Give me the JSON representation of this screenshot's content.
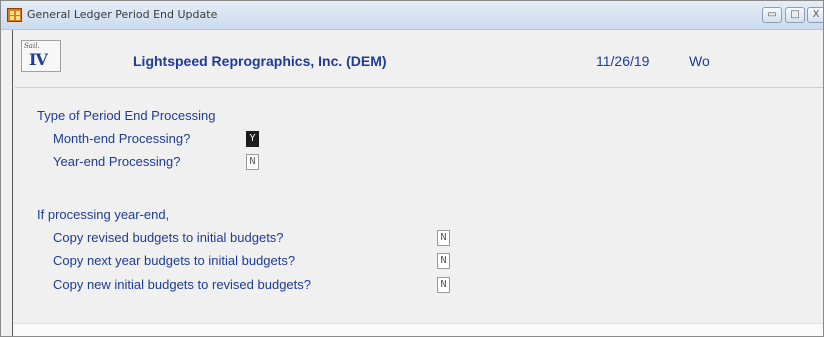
{
  "window": {
    "title": "General Ledger Period End Update",
    "buttons": {
      "minimize": "▭",
      "maximize": "□",
      "close": "X"
    }
  },
  "header": {
    "logo_script": "Sail.",
    "logo_numeral": "IV",
    "company": "Lightspeed Reprographics, Inc. (DEM)",
    "date": "11/26/19",
    "user": "Wo"
  },
  "form": {
    "section1_label": "Type of Period End Processing",
    "month_end_label": "Month-end Processing?",
    "month_end_value": "Y",
    "year_end_label": "Year-end Processing?",
    "year_end_value": "N",
    "section2_label": "If processing year-end,",
    "copy_revised_label": "Copy revised budgets to initial budgets?",
    "copy_revised_value": "N",
    "copy_next_label": "Copy next year budgets to initial budgets?",
    "copy_next_value": "N",
    "copy_new_label": "Copy new initial budgets to revised budgets?",
    "copy_new_value": "N"
  }
}
